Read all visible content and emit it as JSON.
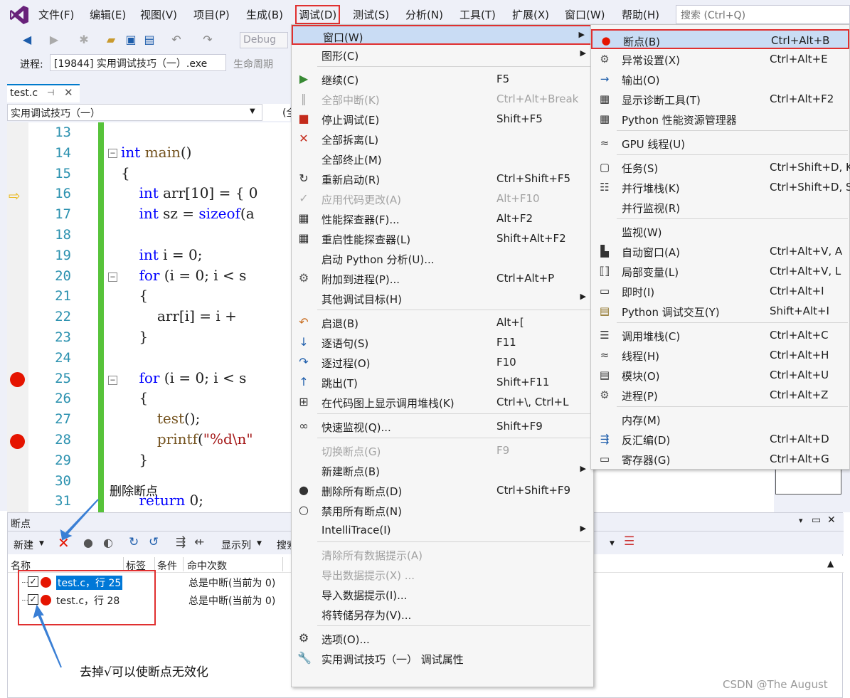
{
  "menubar": {
    "items": [
      "文件(F)",
      "编辑(E)",
      "视图(V)",
      "项目(P)",
      "生成(B)",
      "调试(D)",
      "测试(S)",
      "分析(N)",
      "工具(T)",
      "扩展(X)",
      "窗口(W)",
      "帮助(H)"
    ],
    "search_placeholder": "搜索 (Ctrl+Q)"
  },
  "toolbar": {
    "config": "Debug"
  },
  "process": {
    "label": "进程:",
    "value": "[19844] 实用调试技巧（一）.exe",
    "lifecycle": "生命周期"
  },
  "editor": {
    "tab": "test.c",
    "nav_scope": "实用调试技巧（一）",
    "nav_scope2": "(全",
    "lines": [
      {
        "n": "13",
        "code": ""
      },
      {
        "n": "14",
        "code": "int main()"
      },
      {
        "n": "15",
        "code": "{"
      },
      {
        "n": "16",
        "code": "    int arr[10] = { 0"
      },
      {
        "n": "17",
        "code": "    int sz = sizeof(a"
      },
      {
        "n": "18",
        "code": ""
      },
      {
        "n": "19",
        "code": "    int i = 0;"
      },
      {
        "n": "20",
        "code": "    for (i = 0; i < s"
      },
      {
        "n": "21",
        "code": "    {"
      },
      {
        "n": "22",
        "code": "        arr[i] = i +"
      },
      {
        "n": "23",
        "code": "    }"
      },
      {
        "n": "24",
        "code": ""
      },
      {
        "n": "25",
        "code": "    for (i = 0; i < s"
      },
      {
        "n": "26",
        "code": "    {"
      },
      {
        "n": "27",
        "code": "        test();"
      },
      {
        "n": "28",
        "code": "        printf(\"%d\\n\""
      },
      {
        "n": "29",
        "code": "    }"
      },
      {
        "n": "30",
        "code": ""
      },
      {
        "n": "31",
        "code": "    return 0;"
      }
    ]
  },
  "breakpoints_pane": {
    "title": "断点",
    "new_label": "新建",
    "columns_label": "显示列",
    "search_label": "搜索",
    "headers": [
      "名称",
      "标签",
      "条件",
      "命中次数"
    ],
    "rows": [
      {
        "name": "test.c，行 25",
        "hit": "总是中断(当前为 0)",
        "checked": true
      },
      {
        "name": "test.c，行 28",
        "hit": "总是中断(当前为 0)",
        "checked": true
      }
    ]
  },
  "annotations": {
    "delete_bp": "删除断点",
    "disable_tip": "去掉√可以使断点无效化"
  },
  "debug_menu": {
    "items": [
      {
        "label": "窗口(W)",
        "sc": "",
        "sub": true,
        "icon": "",
        "disabled": false
      },
      {
        "label": "图形(C)",
        "sc": "",
        "sub": true,
        "icon": "",
        "disabled": false
      },
      {
        "label": "继续(C)",
        "sc": "F5",
        "icon": "play-icon",
        "disabled": false
      },
      {
        "label": "全部中断(K)",
        "sc": "Ctrl+Alt+Break",
        "icon": "pause-icon",
        "disabled": true
      },
      {
        "label": "停止调试(E)",
        "sc": "Shift+F5",
        "icon": "stop-icon",
        "disabled": false
      },
      {
        "label": "全部拆离(L)",
        "sc": "",
        "icon": "close-icon",
        "disabled": false
      },
      {
        "label": "全部终止(M)",
        "sc": "",
        "icon": "",
        "disabled": false
      },
      {
        "label": "重新启动(R)",
        "sc": "Ctrl+Shift+F5",
        "icon": "restart-icon",
        "disabled": false
      },
      {
        "label": "应用代码更改(A)",
        "sc": "Alt+F10",
        "icon": "apply-code-icon",
        "disabled": true
      },
      {
        "label": "性能探查器(F)...",
        "sc": "Alt+F2",
        "icon": "profiler-icon",
        "disabled": false
      },
      {
        "label": "重启性能探查器(L)",
        "sc": "Shift+Alt+F2",
        "icon": "profiler-icon",
        "disabled": false
      },
      {
        "label": "启动 Python 分析(U)...",
        "sc": "",
        "icon": "",
        "disabled": false
      },
      {
        "label": "附加到进程(P)...",
        "sc": "Ctrl+Alt+P",
        "icon": "attach-icon",
        "disabled": false
      },
      {
        "label": "其他调试目标(H)",
        "sc": "",
        "sub": true,
        "icon": "",
        "disabled": false
      },
      {
        "label": "启退(B)",
        "sc": "Alt+[",
        "icon": "step-back-icon",
        "disabled": false
      },
      {
        "label": "逐语句(S)",
        "sc": "F11",
        "icon": "step-into-icon",
        "disabled": false
      },
      {
        "label": "逐过程(O)",
        "sc": "F10",
        "icon": "step-over-icon",
        "disabled": false
      },
      {
        "label": "跳出(T)",
        "sc": "Shift+F11",
        "icon": "step-out-icon",
        "disabled": false
      },
      {
        "label": "在代码图上显示调用堆栈(K)",
        "sc": "Ctrl+\\, Ctrl+L",
        "icon": "code-map-icon",
        "disabled": false
      },
      {
        "label": "快速监视(Q)...",
        "sc": "Shift+F9",
        "icon": "glasses-icon",
        "disabled": false
      },
      {
        "label": "切换断点(G)",
        "sc": "F9",
        "icon": "",
        "disabled": true
      },
      {
        "label": "新建断点(B)",
        "sc": "",
        "sub": true,
        "icon": "",
        "disabled": false
      },
      {
        "label": "删除所有断点(D)",
        "sc": "Ctrl+Shift+F9",
        "icon": "delete-breakpoints-icon",
        "disabled": false
      },
      {
        "label": "禁用所有断点(N)",
        "sc": "",
        "icon": "disable-breakpoints-icon",
        "disabled": false
      },
      {
        "label": "IntelliTrace(I)",
        "sc": "",
        "sub": true,
        "icon": "",
        "disabled": false
      },
      {
        "label": "清除所有数据提示(A)",
        "sc": "",
        "icon": "",
        "disabled": true
      },
      {
        "label": "导出数据提示(X) ...",
        "sc": "",
        "icon": "",
        "disabled": true
      },
      {
        "label": "导入数据提示(I)...",
        "sc": "",
        "icon": "",
        "disabled": false
      },
      {
        "label": "将转储另存为(V)...",
        "sc": "",
        "icon": "",
        "disabled": false
      },
      {
        "label": "选项(O)...",
        "sc": "",
        "icon": "gear-icon",
        "disabled": false
      },
      {
        "label": "实用调试技巧（一） 调试属性",
        "sc": "",
        "icon": "wrench-icon",
        "disabled": false
      }
    ]
  },
  "window_menu": {
    "items": [
      {
        "label": "断点(B)",
        "sc": "Ctrl+Alt+B",
        "icon": "breakpoint-window-icon"
      },
      {
        "label": "异常设置(X)",
        "sc": "Ctrl+Alt+E",
        "icon": "exception-icon"
      },
      {
        "label": "输出(O)",
        "sc": "",
        "icon": "output-icon"
      },
      {
        "label": "显示诊断工具(T)",
        "sc": "Ctrl+Alt+F2",
        "icon": "diagnostics-icon"
      },
      {
        "label": "Python 性能资源管理器",
        "sc": "",
        "icon": "python-perf-icon"
      },
      {
        "label": "GPU 线程(U)",
        "sc": "",
        "icon": "gpu-threads-icon"
      },
      {
        "label": "任务(S)",
        "sc": "Ctrl+Shift+D, K",
        "icon": "tasks-icon"
      },
      {
        "label": "并行堆栈(K)",
        "sc": "Ctrl+Shift+D, S",
        "icon": "parallel-stacks-icon"
      },
      {
        "label": "并行监视(R)",
        "sc": "",
        "icon": ""
      },
      {
        "label": "监视(W)",
        "sc": "",
        "icon": ""
      },
      {
        "label": "自动窗口(A)",
        "sc": "Ctrl+Alt+V, A",
        "icon": "autos-icon"
      },
      {
        "label": "局部变量(L)",
        "sc": "Ctrl+Alt+V, L",
        "icon": "locals-icon"
      },
      {
        "label": "即时(I)",
        "sc": "Ctrl+Alt+I",
        "icon": "immediate-icon"
      },
      {
        "label": "Python 调试交互(Y)",
        "sc": "Shift+Alt+I",
        "icon": "python-interactive-icon"
      },
      {
        "label": "调用堆栈(C)",
        "sc": "Ctrl+Alt+C",
        "icon": "call-stack-icon"
      },
      {
        "label": "线程(H)",
        "sc": "Ctrl+Alt+H",
        "icon": "threads-icon"
      },
      {
        "label": "模块(O)",
        "sc": "Ctrl+Alt+U",
        "icon": "modules-icon"
      },
      {
        "label": "进程(P)",
        "sc": "Ctrl+Alt+Z",
        "icon": "processes-icon"
      },
      {
        "label": "内存(M)",
        "sc": "",
        "icon": ""
      },
      {
        "label": "反汇编(D)",
        "sc": "Ctrl+Alt+D",
        "icon": "disassembly-icon"
      },
      {
        "label": "寄存器(G)",
        "sc": "Ctrl+Alt+G",
        "icon": "registers-icon"
      }
    ]
  },
  "watermark": "CSDN @The   August",
  "colors": {
    "highlight_border": "#e03030",
    "breakpoint": "#e51400",
    "accent": "#007acc"
  }
}
